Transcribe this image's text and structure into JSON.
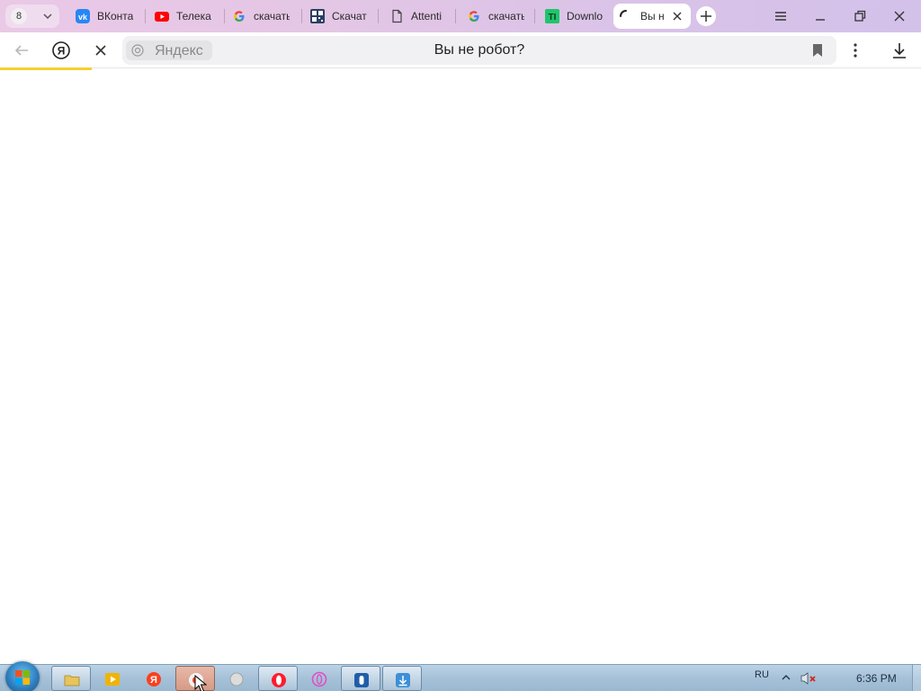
{
  "tabstrip": {
    "tab_count": "8",
    "tabs": [
      {
        "title": "ВКонта",
        "favicon": "vk-icon"
      },
      {
        "title": "Телека",
        "favicon": "youtube-icon"
      },
      {
        "title": "скачать",
        "favicon": "google-icon"
      },
      {
        "title": "Скачат",
        "favicon": "qr-site-icon"
      },
      {
        "title": "Attenti",
        "favicon": "document-icon"
      },
      {
        "title": "скачать",
        "favicon": "google-icon"
      },
      {
        "title": "Downlo",
        "favicon": "ti-icon"
      },
      {
        "title": "Вы н",
        "favicon": "loading-spinner-icon",
        "active": true
      }
    ]
  },
  "toolbar": {
    "search_chip": "Яндекс",
    "page_title": "Вы не робот?"
  },
  "taskbar": {
    "language": "RU",
    "clock": "6:36 PM"
  },
  "colors": {
    "tabstrip_bg": "#e4c6e5",
    "progress": "#f6cf31",
    "vk": "#2787f5",
    "youtube": "#ff0000",
    "yandex_red": "#fc3f1d",
    "opera_red": "#ff1b2d"
  }
}
